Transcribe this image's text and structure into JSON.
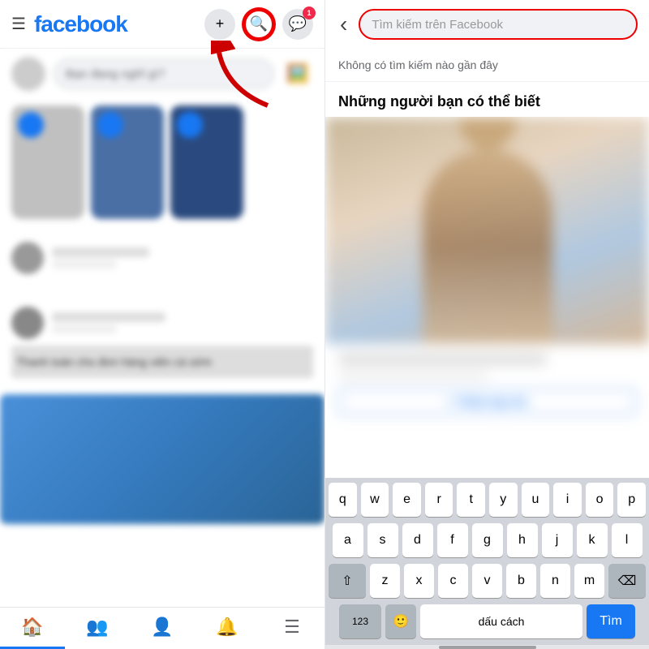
{
  "app": {
    "name": "facebook",
    "logo": "facebook"
  },
  "left": {
    "header": {
      "menu_label": "☰",
      "add_label": "+",
      "search_label": "🔍",
      "messenger_label": "💬",
      "messenger_badge": "1"
    },
    "status_bar": {
      "placeholder": "Bạn đang nghĩ gì?"
    },
    "nav": {
      "home_label": "🏠",
      "friends_label": "👥",
      "profile_label": "👤",
      "bell_label": "🔔",
      "menu_label": "☰"
    },
    "post_text": "Thanh toán cho đơn hàng\nviên cá sớm"
  },
  "right": {
    "header": {
      "back_label": "‹",
      "search_placeholder": "Tìm kiếm trên Facebook"
    },
    "no_recent_label": "Không có tìm kiếm nào gần đây",
    "people_section_label": "Những người bạn có thể biết",
    "keyboard": {
      "row1": [
        "q",
        "w",
        "e",
        "r",
        "t",
        "y",
        "u",
        "i",
        "o",
        "p"
      ],
      "row2": [
        "a",
        "s",
        "d",
        "f",
        "g",
        "h",
        "j",
        "k",
        "l"
      ],
      "row3": [
        "z",
        "x",
        "c",
        "v",
        "b",
        "n",
        "m"
      ],
      "shift_label": "⇧",
      "delete_label": "⌫",
      "numbers_label": "123",
      "emoji_label": "🙂",
      "space_label": "dấu cách",
      "return_label": "Tìm"
    }
  }
}
